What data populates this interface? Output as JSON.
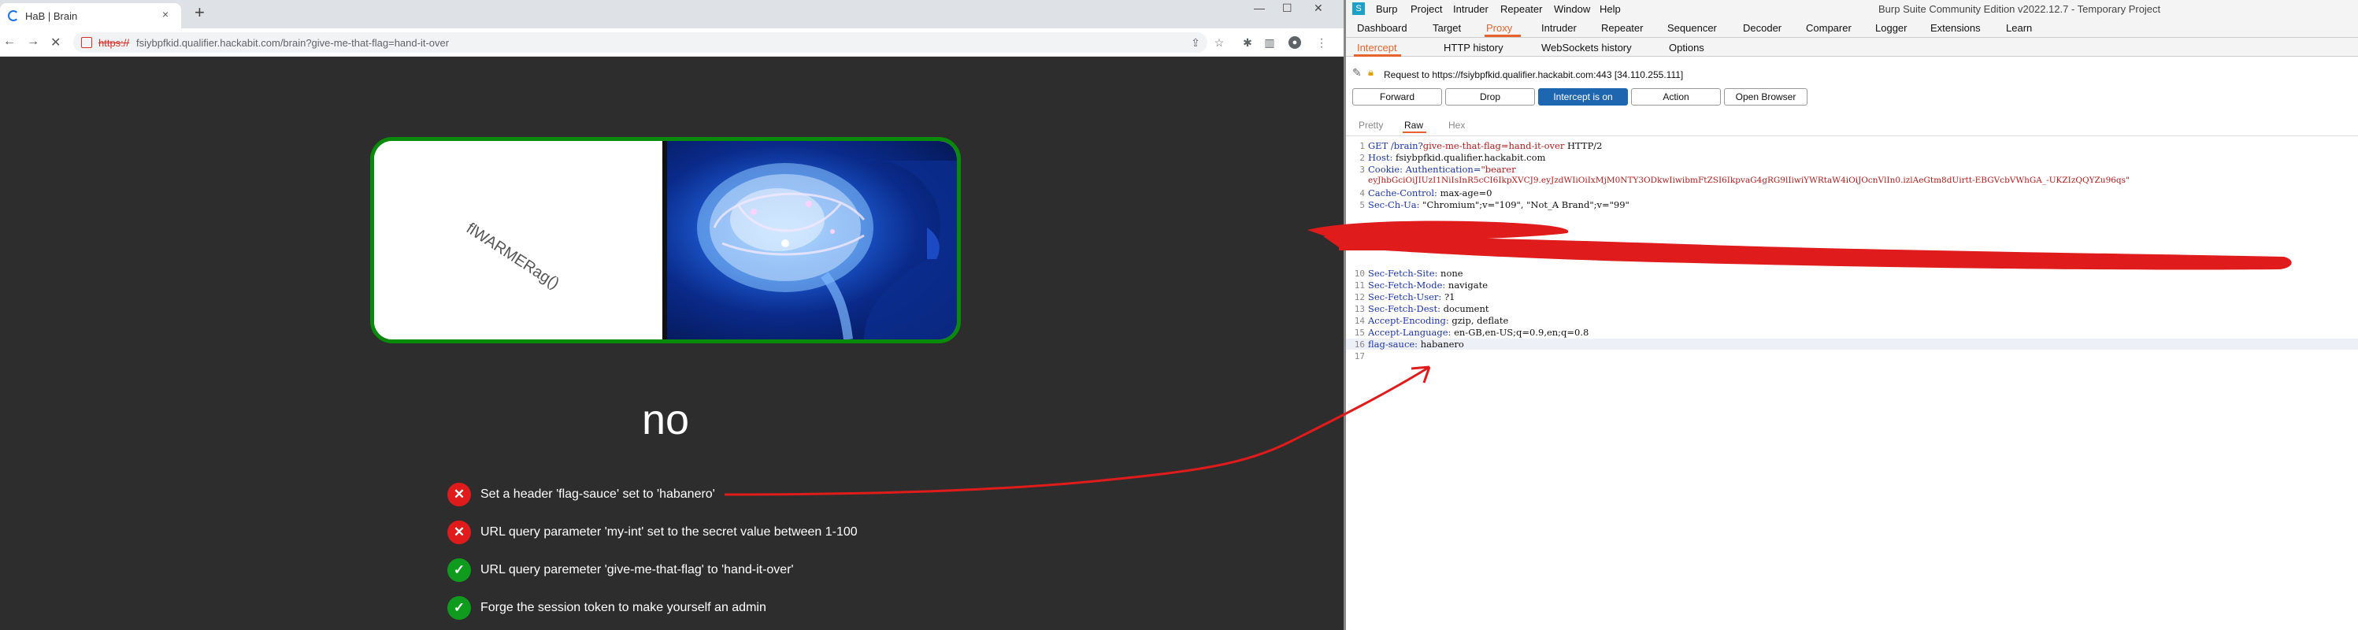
{
  "browser": {
    "tab_title": "HaB | Brain",
    "tab_close": "×",
    "new_tab": "+",
    "window_controls": [
      "—",
      "☐",
      "✕"
    ],
    "url_scheme": "https://",
    "url_rest": "fsiybpfkid.qualifier.hackabit.com/brain?give-me-that-flag=hand-it-over",
    "nav": [
      "←",
      "→",
      "✕"
    ],
    "toolbar_icons": [
      "share-icon",
      "star-icon",
      "extension-icon",
      "sidebar-icon",
      "profile-icon",
      "menu-icon"
    ]
  },
  "page": {
    "hero_rotated_text": "flWARMERag()",
    "heading": "no",
    "checks": [
      {
        "status": "fail",
        "text": "Set a header 'flag-sauce' set to 'habanero'"
      },
      {
        "status": "fail",
        "text": "URL query parameter 'my-int' set to the secret value between 1-100"
      },
      {
        "status": "pass",
        "text": "URL query paremeter 'give-me-that-flag' to 'hand-it-over'"
      },
      {
        "status": "pass",
        "text": "Forge the session token to make yourself an admin"
      }
    ]
  },
  "burp": {
    "logo": "S",
    "menu": [
      "Burp",
      "Project",
      "Intruder",
      "Repeater",
      "Window",
      "Help"
    ],
    "title": "Burp Suite Community Edition v2022.12.7 - Temporary Project",
    "tabs": [
      "Dashboard",
      "Target",
      "Proxy",
      "Intruder",
      "Repeater",
      "Sequencer",
      "Decoder",
      "Comparer",
      "Logger",
      "Extensions",
      "Learn"
    ],
    "active_tab": "Proxy",
    "subtabs": [
      "Intercept",
      "HTTP history",
      "WebSockets history",
      "Options"
    ],
    "active_subtab": "Intercept",
    "request_info": "Request to https://fsiybpfkid.qualifier.hackabit.com:443  [34.110.255.111]",
    "buttons": [
      "Forward",
      "Drop",
      "Intercept is on",
      "Action",
      "Open Browser"
    ],
    "view_tabs": [
      "Pretty",
      "Raw",
      "Hex"
    ],
    "active_view": "Raw",
    "lines": [
      {
        "n": "1",
        "k": "GET /brain?",
        "v": "give-me-that-flag=hand-it-over",
        "rest": " HTTP/2"
      },
      {
        "n": "2",
        "k": "Host:",
        "rest": " fsiybpfkid.qualifier.hackabit.com"
      },
      {
        "n": "3",
        "k": "Cookie: Authentication=",
        "v": "\"bearer"
      },
      {
        "n": "",
        "v": "eyJhbGciOiJIUzI1NiIsInR5cCI6IkpXVCJ9.eyJzdWIiOiIxMjM0NTY3ODkwIiwibmFtZSI6IkpvaG4gRG9lIiwiYWRtaW4iOiJOcnVlIn0.izlAeGtm8dUirtt-EBGVcbVWhGA_-UKZIzQQYZu96qs\""
      },
      {
        "n": "4",
        "k": "Cache-Control:",
        "rest": " max-age=0"
      },
      {
        "n": "5",
        "k": "Sec-Ch-Ua:",
        "rest": " \"Chromium\";v=\"109\", \"Not_A Brand\";v=\"99\""
      },
      {
        "n": "10",
        "k": "Sec-Fetch-Site:",
        "rest": " none"
      },
      {
        "n": "11",
        "k": "Sec-Fetch-Mode:",
        "rest": " navigate"
      },
      {
        "n": "12",
        "k": "Sec-Fetch-User:",
        "rest": " ?1"
      },
      {
        "n": "13",
        "k": "Sec-Fetch-Dest:",
        "rest": " document"
      },
      {
        "n": "14",
        "k": "Accept-Encoding:",
        "rest": " gzip, deflate"
      },
      {
        "n": "15",
        "k": "Accept-Language:",
        "rest": " en-GB,en-US;q=0.9,en;q=0.8"
      },
      {
        "n": "16",
        "k": "flag-sauce:",
        "rest": " habanero"
      },
      {
        "n": "17",
        "k": "",
        "rest": ""
      }
    ]
  },
  "colors": {
    "fail": "#e01b1b",
    "pass": "#0f9b1e",
    "burp_accent": "#e8632b",
    "intercept_on": "#1f66b0",
    "annotation": "#e01b1b"
  }
}
